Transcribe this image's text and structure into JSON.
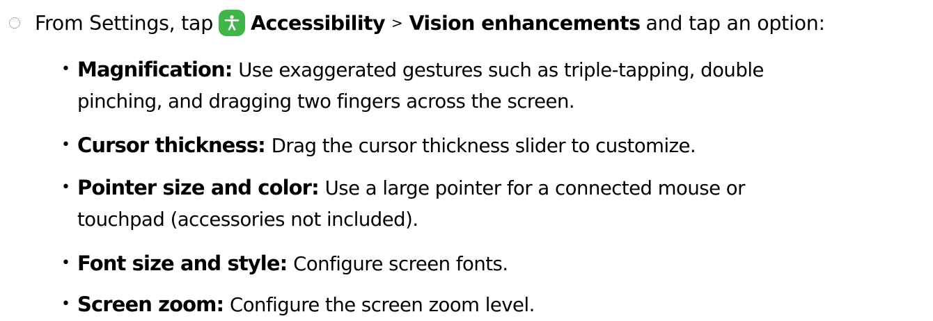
{
  "step": {
    "prefix": "From Settings, tap",
    "app_name": "Accessibility",
    "separator": ">",
    "menu_name": "Vision enhancements",
    "suffix": "and tap an option:",
    "app_icon": "accessibility-icon",
    "app_icon_color": "#3fb54a"
  },
  "options": [
    {
      "label": "Magnification:",
      "lines": [
        "Use exaggerated gestures such as triple-tapping, double",
        "pinching, and dragging two fingers across the screen."
      ]
    },
    {
      "label": "Cursor thickness:",
      "lines": [
        "Drag the cursor thickness slider to customize."
      ]
    },
    {
      "label": "Pointer size and color:",
      "lines": [
        "Use a large pointer for a connected mouse or",
        "touchpad (accessories not included)."
      ]
    },
    {
      "label": "Font size and style:",
      "lines": [
        "Configure screen fonts."
      ]
    },
    {
      "label": "Screen zoom:",
      "lines": [
        "Configure the screen zoom level."
      ]
    }
  ],
  "bullet_glyph": "•"
}
